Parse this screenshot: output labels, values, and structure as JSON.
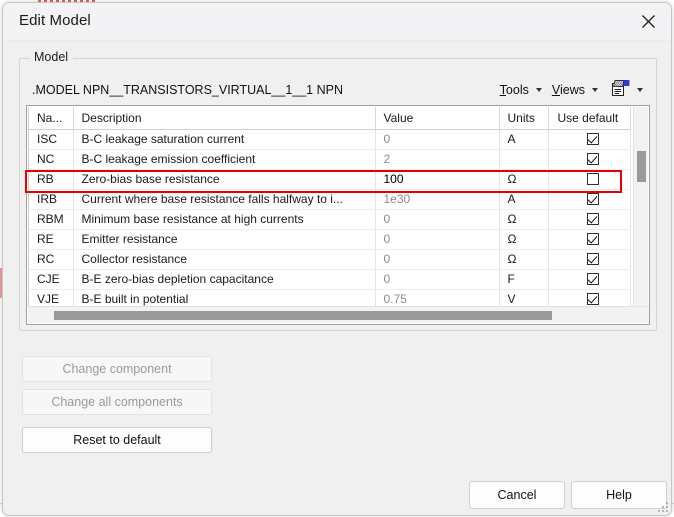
{
  "window": {
    "title": "Edit Model",
    "close_icon": "close-icon"
  },
  "group": {
    "legend": "Model",
    "model_line": ".MODEL NPN__TRANSISTORS_VIRTUAL__1__1 NPN"
  },
  "toolbar": {
    "tools_label": "Tools",
    "tools_mnemonic": "T",
    "views_label": "Views",
    "views_mnemonic": "V",
    "clipboard_icon": "clipboard-icon",
    "dropdown_icon": "chevron-down-icon"
  },
  "table": {
    "columns": [
      "Na...",
      "Description",
      "Value",
      "Units",
      "Use default"
    ],
    "rows": [
      {
        "name": "ISC",
        "description": "B-C leakage saturation current",
        "value": "0",
        "units": "A",
        "use_default": true
      },
      {
        "name": "NC",
        "description": "B-C leakage emission coefficient",
        "value": "2",
        "units": "",
        "use_default": true
      },
      {
        "name": "RB",
        "description": "Zero-bias base resistance",
        "value": "100",
        "units": "Ω",
        "use_default": false
      },
      {
        "name": "IRB",
        "description": "Current where base resistance falls halfway to i...",
        "value": "1e30",
        "units": "A",
        "use_default": true
      },
      {
        "name": "RBM",
        "description": "Minimum base resistance at high currents",
        "value": "0",
        "units": "Ω",
        "use_default": true
      },
      {
        "name": "RE",
        "description": "Emitter resistance",
        "value": "0",
        "units": "Ω",
        "use_default": true
      },
      {
        "name": "RC",
        "description": "Collector resistance",
        "value": "0",
        "units": "Ω",
        "use_default": true
      },
      {
        "name": "CJE",
        "description": "B-E zero-bias depletion capacitance",
        "value": "0",
        "units": "F",
        "use_default": true
      },
      {
        "name": "VJE",
        "description": "B-E built in potential",
        "value": "0.75",
        "units": "V",
        "use_default": true
      }
    ],
    "highlighted_row_name": "RB",
    "highlight_color": "#e60000"
  },
  "actions": {
    "change_component": "Change component",
    "change_all_components": "Change all components",
    "reset_to_default": "Reset to default"
  },
  "footer": {
    "cancel": "Cancel",
    "help": "Help"
  }
}
